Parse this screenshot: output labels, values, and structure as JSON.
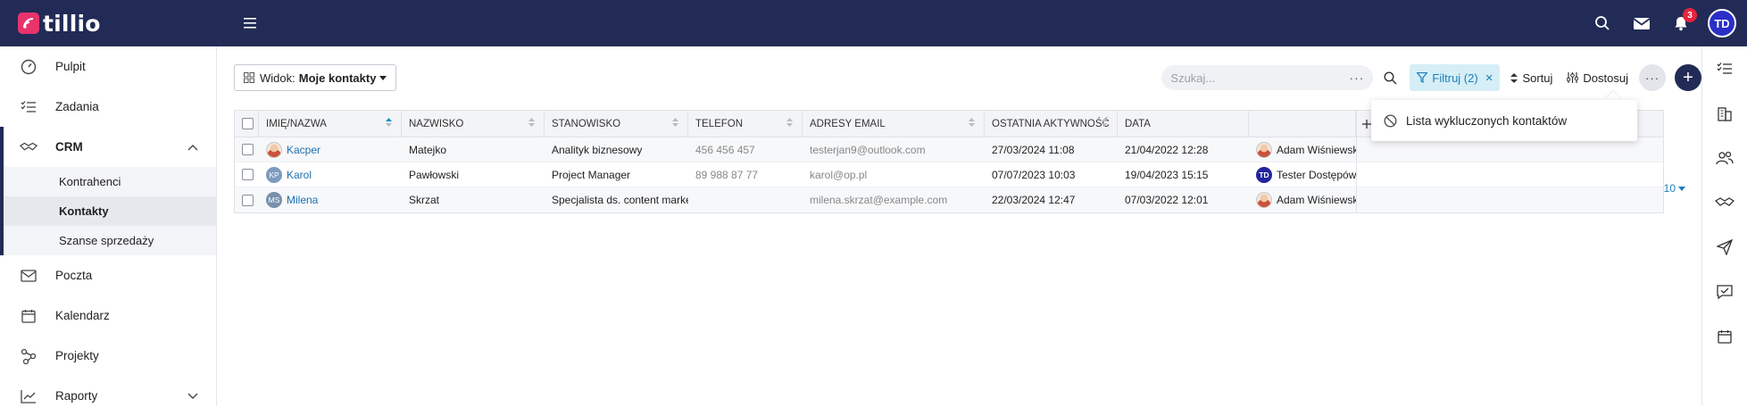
{
  "app": {
    "brand": "tillio",
    "brand_color": "#e8336d",
    "topbar_color": "#222b56"
  },
  "topbar": {
    "notifications_count": "3",
    "user_initials": "TD"
  },
  "sidebar": {
    "items": [
      {
        "label": "Pulpit",
        "icon": "dashboard-icon"
      },
      {
        "label": "Zadania",
        "icon": "tasks-icon"
      },
      {
        "label": "CRM",
        "icon": "crm-icon"
      },
      {
        "label": "Poczta",
        "icon": "mail-icon"
      },
      {
        "label": "Kalendarz",
        "icon": "calendar-icon"
      },
      {
        "label": "Projekty",
        "icon": "projects-icon"
      },
      {
        "label": "Raporty",
        "icon": "reports-icon"
      }
    ],
    "crm_sub": [
      {
        "label": "Kontrahenci"
      },
      {
        "label": "Kontakty"
      },
      {
        "label": "Szanse sprzedaży"
      }
    ]
  },
  "toolbar": {
    "view_prefix": "Widok:",
    "view_name": "Moje kontakty",
    "search_placeholder": "Szukaj...",
    "filter_label": "Filtruj (2)",
    "sort_label": "Sortuj",
    "customize_label": "Dostosuj"
  },
  "dropdown": {
    "item_label": "Lista wykluczonych kontaktów"
  },
  "table": {
    "headers": [
      "Imię/nazwa",
      "Nazwisko",
      "Stanowisko",
      "Telefon",
      "Adresy email",
      "Ostatnia aktywność",
      "Data",
      ""
    ],
    "rows": [
      {
        "avatar": "",
        "first": "Kacper",
        "last": "Matejko",
        "position": "Analityk biznesowy",
        "phone": "456 456 457",
        "email": "testerjan9@outlook.com",
        "last_activity": "27/03/2024 11:08",
        "date": "21/04/2022 12:28",
        "owner": "Adam Wiśniewski",
        "owner_avatar": ""
      },
      {
        "avatar": "KP",
        "first": "Karol",
        "last": "Pawłowski",
        "position": "Project Manager",
        "phone": "89 988 87 77",
        "email": "karol@op.pl",
        "last_activity": "07/07/2023 10:03",
        "date": "19/04/2023 15:15",
        "owner": "Tester Dostępów",
        "owner_avatar": "TD"
      },
      {
        "avatar": "MS",
        "first": "Milena",
        "last": "Skrzat",
        "position": "Specjalista ds. content marketin...",
        "phone": "",
        "email": "milena.skrzat@example.com",
        "last_activity": "22/03/2024 12:47",
        "date": "07/03/2022 12:01",
        "owner": "Adam Wiśniewski",
        "owner_avatar": ""
      }
    ]
  },
  "pager": {
    "page_size": "10"
  }
}
